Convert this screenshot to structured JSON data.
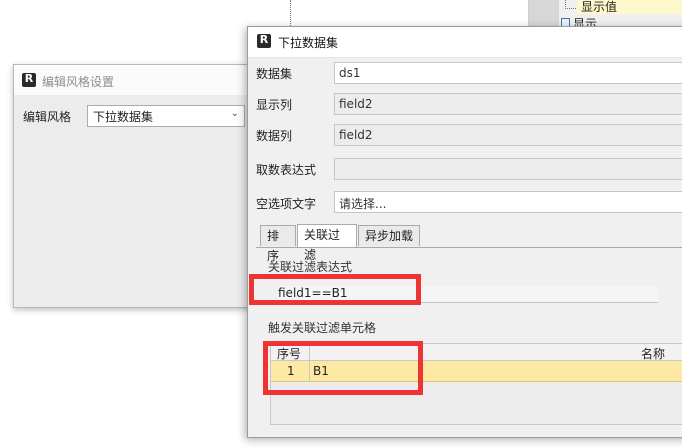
{
  "background": {
    "tree_node_label": "显示值",
    "tree_node_label2": "显示"
  },
  "left_dialog": {
    "icon_letter": "R",
    "title": "编辑风格设置",
    "style_label": "编辑风格",
    "style_value": "下拉数据集"
  },
  "main_dialog": {
    "icon_letter": "R",
    "title": "下拉数据集",
    "fields": [
      {
        "label": "数据集",
        "value": "ds1"
      },
      {
        "label": "显示列",
        "value": "field2"
      },
      {
        "label": "数据列",
        "value": "field2"
      },
      {
        "label": "取数表达式",
        "value": ""
      },
      {
        "label": "空选项文字",
        "value": "请选择..."
      }
    ],
    "tabs": [
      "排序",
      "关联过滤",
      "异步加载"
    ],
    "active_tab": "关联过滤",
    "filter_expr_label": "关联过滤表达式",
    "filter_expr_value": "field1==B1",
    "trigger_label": "触发关联过滤单元格",
    "grid": {
      "columns": [
        "序号",
        "名称"
      ],
      "rows": [
        {
          "index": "1",
          "name": "B1"
        }
      ]
    }
  },
  "colors": {
    "highlight": "#ee3333",
    "selected_row": "#fde8a4"
  }
}
